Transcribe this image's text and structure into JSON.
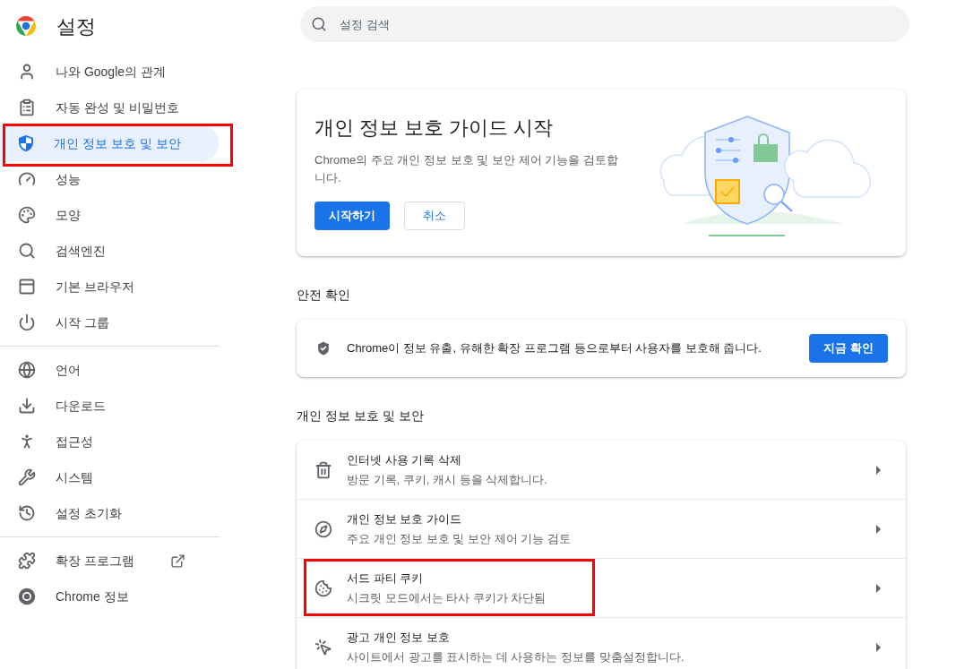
{
  "header": {
    "title": "설정",
    "search": {
      "placeholder": "설정 검색"
    }
  },
  "sidebar": {
    "groups": [
      [
        {
          "label": "나와 Google의 관계",
          "selected": false,
          "highlighted": false
        },
        {
          "label": "자동 완성 및 비밀번호",
          "selected": false,
          "highlighted": false
        },
        {
          "label": "개인 정보 보호 및 보안",
          "selected": true,
          "highlighted": true
        },
        {
          "label": "성능",
          "selected": false,
          "highlighted": false
        },
        {
          "label": "모양",
          "selected": false,
          "highlighted": false
        },
        {
          "label": "검색엔진",
          "selected": false,
          "highlighted": false
        },
        {
          "label": "기본 브라우저",
          "selected": false,
          "highlighted": false
        },
        {
          "label": "시작 그룹",
          "selected": false,
          "highlighted": false
        }
      ],
      [
        {
          "label": "언어",
          "selected": false,
          "highlighted": false
        },
        {
          "label": "다운로드",
          "selected": false,
          "highlighted": false
        },
        {
          "label": "접근성",
          "selected": false,
          "highlighted": false
        },
        {
          "label": "시스템",
          "selected": false,
          "highlighted": false
        },
        {
          "label": "설정 초기화",
          "selected": false,
          "highlighted": false
        }
      ],
      [
        {
          "label": "확장 프로그램",
          "selected": false,
          "highlighted": false,
          "external": true
        },
        {
          "label": "Chrome 정보",
          "selected": false,
          "highlighted": false
        }
      ]
    ]
  },
  "guide_card": {
    "title": "개인 정보 보호 가이드 시작",
    "description": "Chrome의 주요 개인 정보 보호 및 보안 제어 기능을 검토합니다.",
    "primary_button": "시작하기",
    "secondary_button": "취소"
  },
  "safety_check": {
    "heading": "안전 확인",
    "text": "Chrome이 정보 유출, 유해한 확장 프로그램 등으로부터 사용자를 보호해 줍니다.",
    "button": "지금 확인"
  },
  "privacy": {
    "heading": "개인 정보 보호 및 보안",
    "rows": [
      {
        "title": "인터넷 사용 기록 삭제",
        "subtitle": "방문 기록, 쿠키, 캐시 등을 삭제합니다.",
        "highlighted": false
      },
      {
        "title": "개인 정보 보호 가이드",
        "subtitle": "주요 개인 정보 보호 및 보안 제어 기능 검토",
        "highlighted": false
      },
      {
        "title": "서드 파티 쿠키",
        "subtitle": "시크릿 모드에서는 타사 쿠키가 차단됨",
        "highlighted": true
      },
      {
        "title": "광고 개인 정보 보호",
        "subtitle": "사이트에서 광고를 표시하는 데 사용하는 정보를 맞춤설정합니다.",
        "highlighted": false
      }
    ]
  }
}
